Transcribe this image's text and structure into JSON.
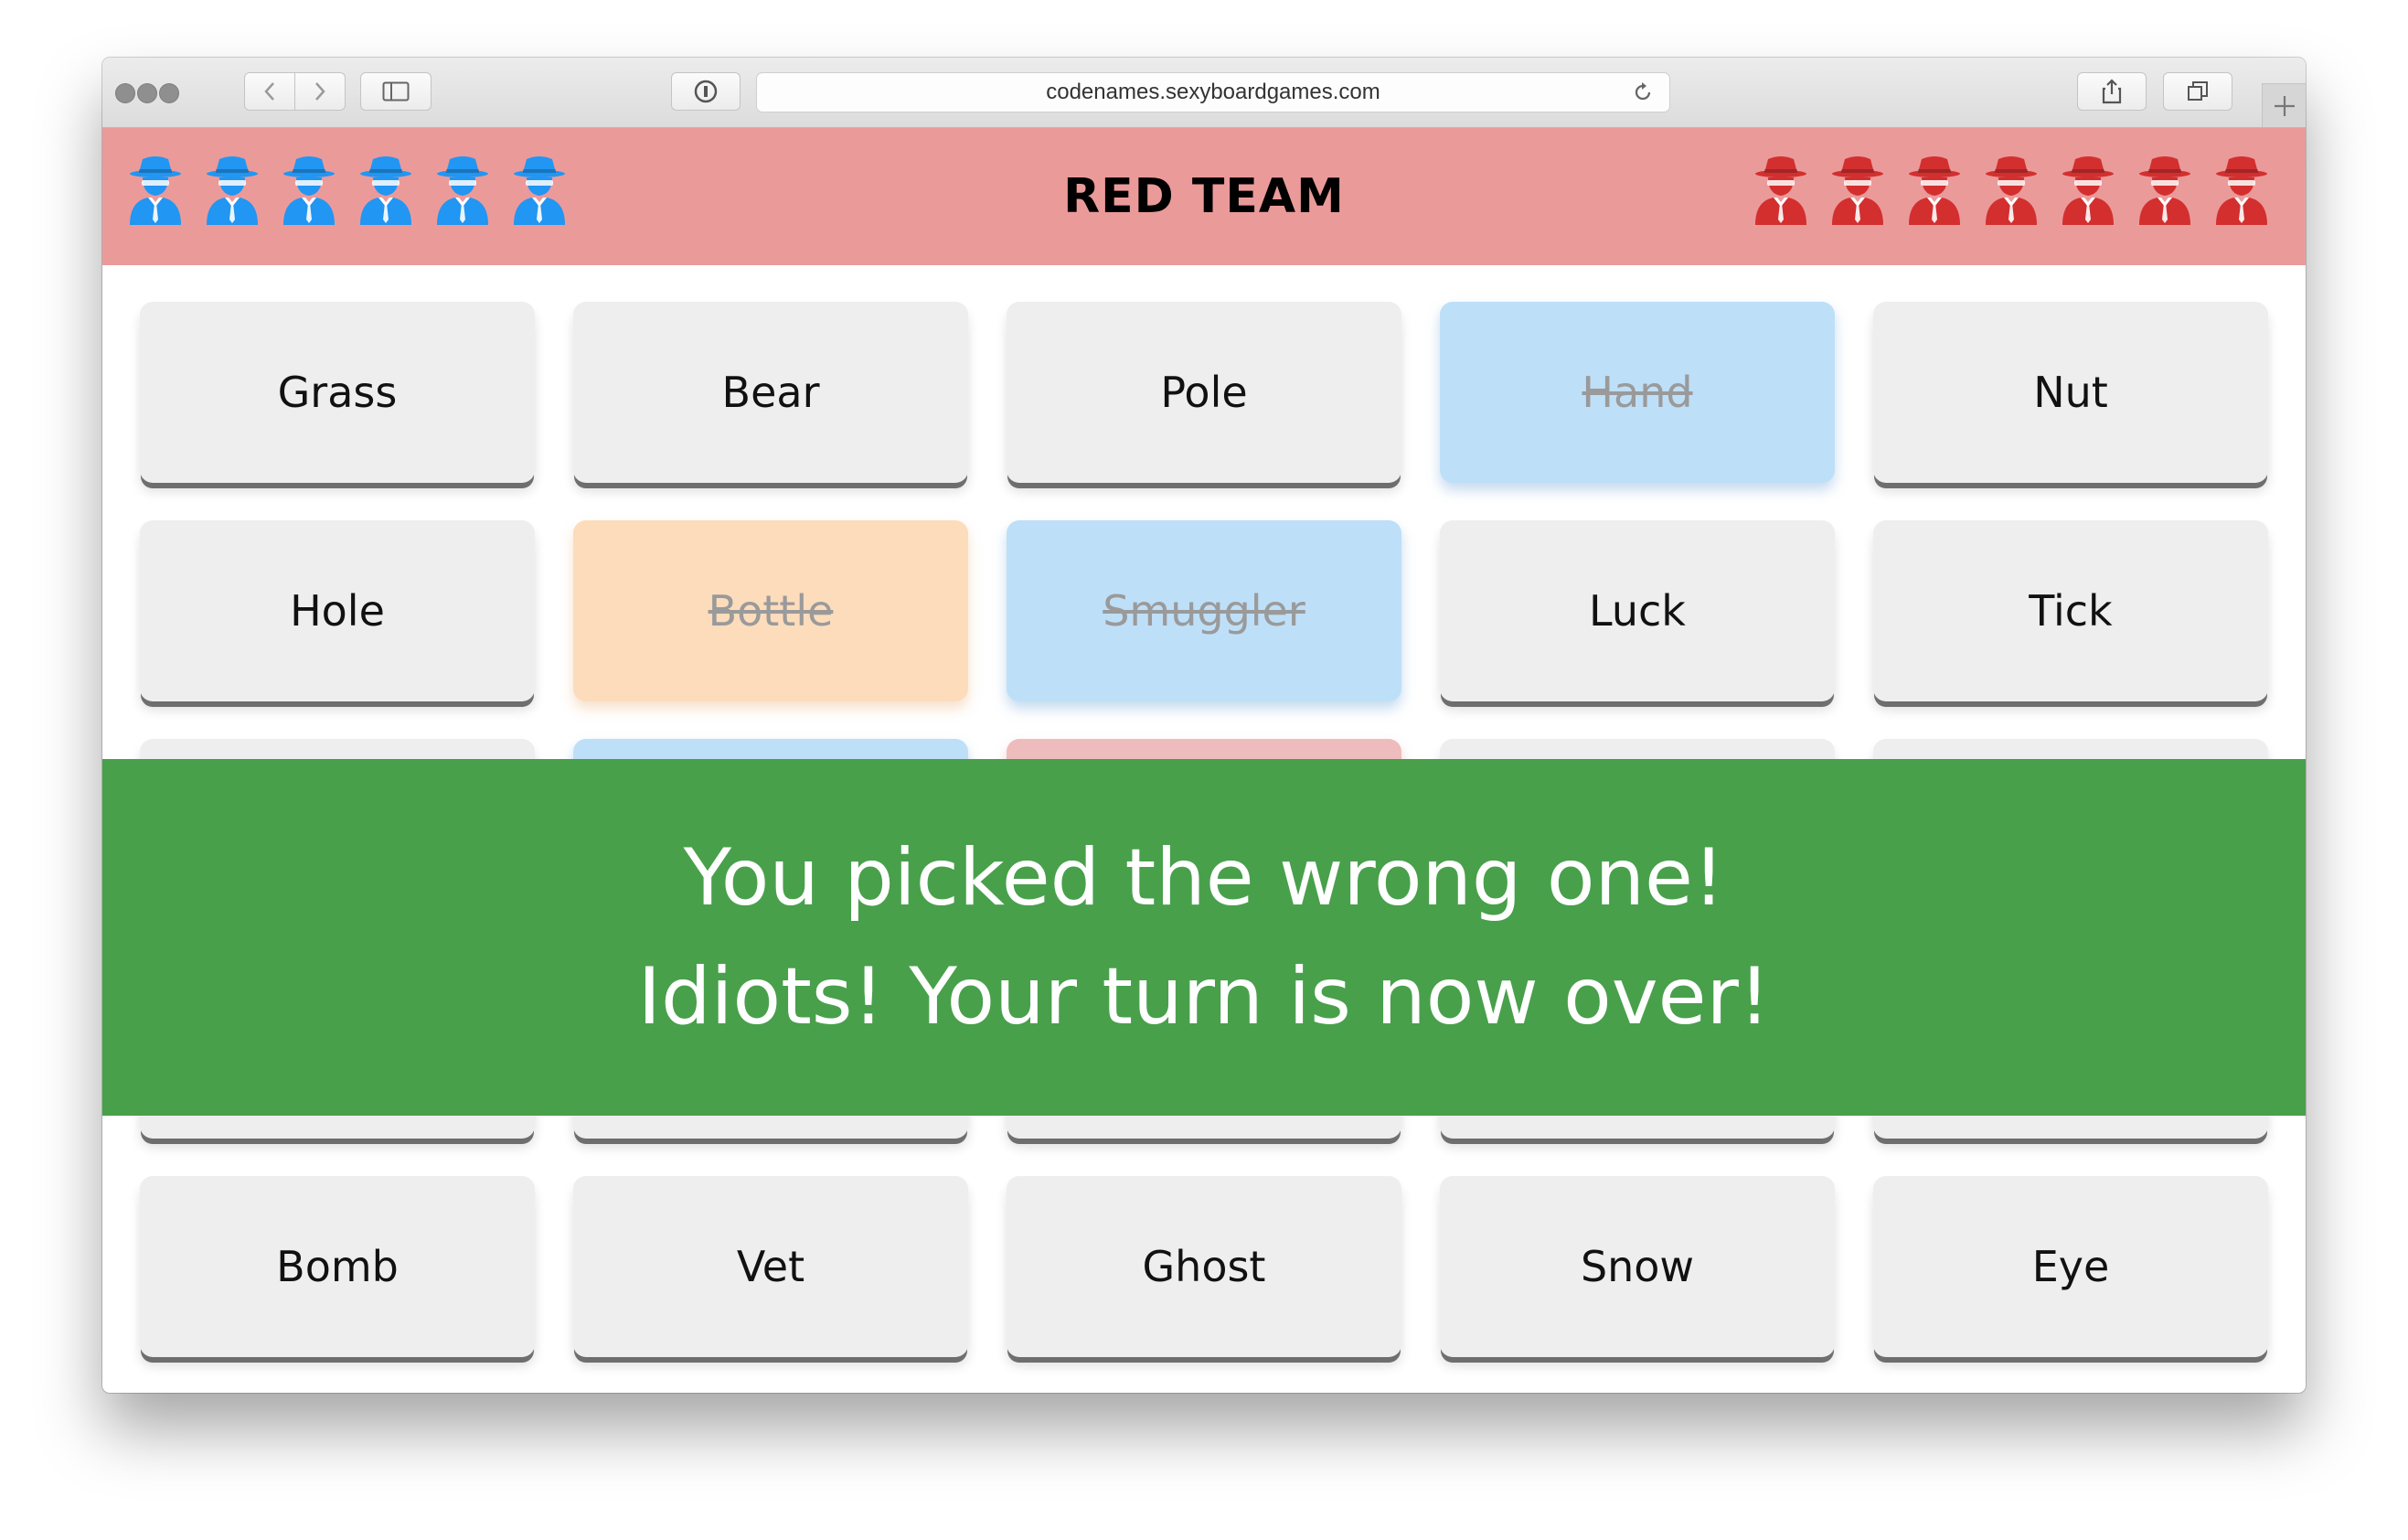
{
  "browser": {
    "url": "codenames.sexyboardgames.com"
  },
  "header": {
    "title": "RED TEAM",
    "blue_agents_remaining": 6,
    "red_agents_remaining": 7,
    "blue_color": "#2196f3",
    "red_color": "#d32f2f",
    "background_color": "#eb9a9a"
  },
  "board": {
    "rows": [
      [
        {
          "word": "Grass",
          "state": "hidden",
          "color": null
        },
        {
          "word": "Bear",
          "state": "hidden",
          "color": null
        },
        {
          "word": "Pole",
          "state": "hidden",
          "color": null
        },
        {
          "word": "Hand",
          "state": "revealed",
          "color": "blue"
        },
        {
          "word": "Nut",
          "state": "hidden",
          "color": null
        }
      ],
      [
        {
          "word": "Hole",
          "state": "hidden",
          "color": null
        },
        {
          "word": "Bottle",
          "state": "revealed",
          "color": "peach"
        },
        {
          "word": "Smuggler",
          "state": "revealed",
          "color": "blue"
        },
        {
          "word": "Luck",
          "state": "hidden",
          "color": null
        },
        {
          "word": "Tick",
          "state": "hidden",
          "color": null
        }
      ],
      [
        {
          "word": "",
          "state": "hidden",
          "color": null
        },
        {
          "word": "",
          "state": "revealed",
          "color": "blue"
        },
        {
          "word": "",
          "state": "revealed",
          "color": "red"
        },
        {
          "word": "",
          "state": "hidden",
          "color": null
        },
        {
          "word": "",
          "state": "hidden",
          "color": null
        }
      ],
      [
        {
          "word": "",
          "state": "hidden",
          "color": null
        },
        {
          "word": "",
          "state": "hidden",
          "color": null
        },
        {
          "word": "",
          "state": "hidden",
          "color": null
        },
        {
          "word": "",
          "state": "hidden",
          "color": null
        },
        {
          "word": "",
          "state": "hidden",
          "color": null
        }
      ],
      [
        {
          "word": "Bomb",
          "state": "hidden",
          "color": null
        },
        {
          "word": "Vet",
          "state": "hidden",
          "color": null
        },
        {
          "word": "Ghost",
          "state": "hidden",
          "color": null
        },
        {
          "word": "Snow",
          "state": "hidden",
          "color": null
        },
        {
          "word": "Eye",
          "state": "hidden",
          "color": null
        }
      ]
    ]
  },
  "banner": {
    "line1": "You picked the wrong one!",
    "line2": "Idiots! Your turn is now over!",
    "background_color": "#48a04b"
  },
  "icons": {
    "agent": "spy-agent-icon",
    "back": "chevron-left-icon",
    "forward": "chevron-right-icon",
    "sidebar": "sidebar-icon",
    "privacy": "privacy-info-icon",
    "reload": "reload-icon",
    "share": "share-icon",
    "tabs": "tabs-icon",
    "new_tab": "plus-icon"
  }
}
